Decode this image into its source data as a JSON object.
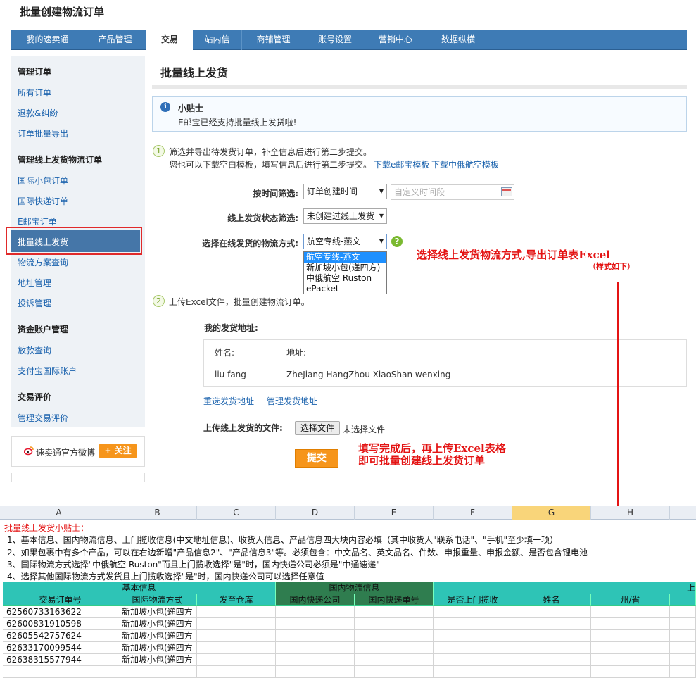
{
  "header": {
    "title": "批量创建物流订单"
  },
  "topnav": {
    "tabs": [
      "我的速卖通",
      "产品管理",
      "交易",
      "站内信",
      "商铺管理",
      "账号设置",
      "营销中心",
      "数据纵横"
    ],
    "active": "交易"
  },
  "sidebar": {
    "groups": [
      {
        "title": "管理订单",
        "items": [
          "所有订单",
          "退款&纠纷",
          "订单批量导出"
        ]
      },
      {
        "title": "管理线上发货物流订单",
        "items": [
          "国际小包订单",
          "国际快递订单",
          "E邮宝订单",
          "批量线上发货",
          "物流方案查询",
          "地址管理",
          "投诉管理"
        ]
      },
      {
        "title": "资金账户管理",
        "items": [
          "放款查询",
          "支付宝国际账户"
        ]
      },
      {
        "title": "交易评价",
        "items": [
          "管理交易评价"
        ]
      }
    ],
    "active_item": "批量线上发货",
    "weibo_text": "速卖通官方微博",
    "follow_label": "+ 关注"
  },
  "main": {
    "title": "批量线上发货",
    "tip": {
      "title": "小贴士",
      "text": "E邮宝已经支持批量线上发货啦!"
    },
    "step1": {
      "num": "1",
      "line1": "筛选并导出待发货订单，补全信息后进行第二步提交。",
      "line2": "您也可以下载空白模板，填写信息后进行第二步提交。",
      "link1": "下载e邮宝模板",
      "link2": "下载中俄航空模板"
    },
    "filters": {
      "time_label": "按时间筛选:",
      "time_value": "订单创建时间",
      "custom_placeholder": "自定义时间段",
      "status_label": "线上发货状态筛选:",
      "status_value": "未创建过线上发货",
      "method_label": "选择在线发货的物流方式:",
      "method_value": "航空专线-燕文",
      "method_options": [
        "航空专线-燕文",
        "新加坡小包(递四方)",
        "中俄航空 Ruston",
        "ePacket"
      ]
    },
    "step2": {
      "num": "2",
      "text": "上传Excel文件，批量创建物流订单。"
    },
    "address": {
      "heading": "我的发货地址:",
      "name_header": "姓名:",
      "addr_header": "地址:",
      "name": "liu fang",
      "addr": "ZheJiang HangZhou XiaoShan wenxing",
      "reselect": "重选发货地址",
      "manage": "管理发货地址"
    },
    "upload": {
      "label": "上传线上发货的文件:",
      "button": "选择文件",
      "status": "未选择文件"
    },
    "submit": "提交"
  },
  "annotations": {
    "a1_line1": "选择线上发货物流方式,导出订单表Excel",
    "a1_line2": "（样式如下）",
    "a2_line1": "填写完成后，再上传Excel表格",
    "a2_line2": "即可批量创建线上发货订单"
  },
  "sheet": {
    "columns": [
      "A",
      "B",
      "C",
      "D",
      "E",
      "F",
      "G",
      "H"
    ],
    "highlighted_column": "G",
    "note_title": "批量线上发货小贴士：",
    "notes": [
      "1、基本信息、国内物流信息、上门揽收信息(中文地址信息)、收货人信息、产品信息四大块内容必填（其中收货人\"联系电话\"、\"手机\"至少填一项）",
      "2、如果包裹中有多个产品，可以在右边新增\"产品信息2\"、\"产品信息3\"等。必须包含：中文品名、英文品名、件数、申报重量、申报金额、是否包含锂电池",
      "3、国际物流方式选择\"中俄航空 Ruston\"而且上门揽收选择\"是\"时，国内快递公司必须是\"中通速递\"",
      "4、选择其他国际物流方式发货且上门揽收选择\"是\"时，国内快递公司可以选择任意值"
    ],
    "group_headers": [
      "基本信息",
      "国内物流信息",
      "上"
    ],
    "headers": [
      "交易订单号",
      "国际物流方式",
      "发至仓库",
      "国内快递公司",
      "国内快递单号",
      "是否上门揽收",
      "姓名",
      "州/省"
    ],
    "rows": [
      [
        "62560733163622",
        "新加坡小包(递四方"
      ],
      [
        "62600831910598",
        "新加坡小包(递四方"
      ],
      [
        "62605542757624",
        "新加坡小包(递四方"
      ],
      [
        "62633170099544",
        "新加坡小包(递四方"
      ],
      [
        "62638315577944",
        "新加坡小包(递四方"
      ]
    ]
  },
  "colors": {
    "nav": "#3e7bb5",
    "accent_orange": "#f6951b",
    "annotation_red": "#e41414",
    "sheet_teal": "#2ec4b6",
    "sheet_green": "#2f7d4f"
  }
}
